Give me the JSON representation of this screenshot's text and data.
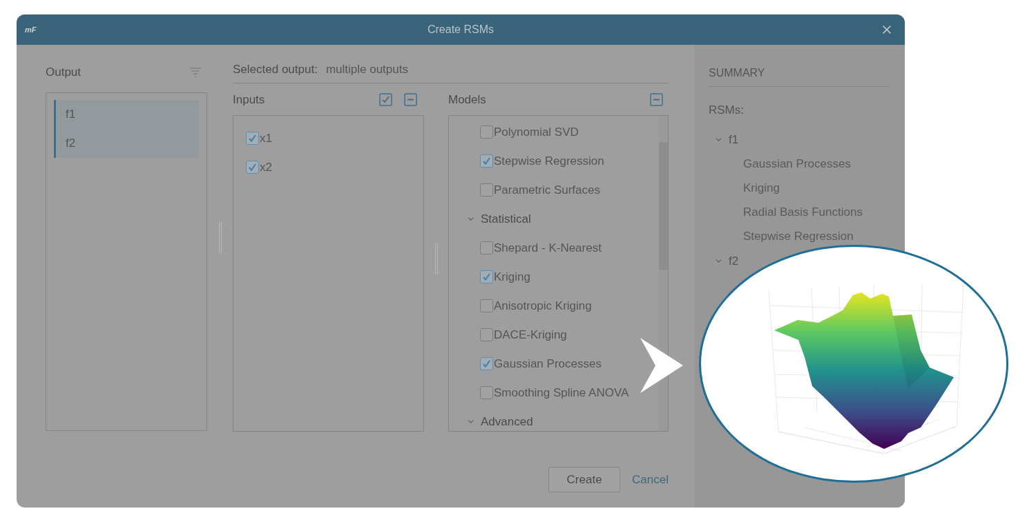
{
  "window": {
    "logo": "mF",
    "title": "Create RSMs"
  },
  "output_panel": {
    "title": "Output",
    "items": [
      {
        "label": "f1",
        "selected": true
      },
      {
        "label": "f2",
        "selected": true
      }
    ]
  },
  "selected_output": {
    "label": "Selected output:",
    "value": "multiple outputs"
  },
  "inputs": {
    "title": "Inputs",
    "items": [
      {
        "label": "x1",
        "checked": true
      },
      {
        "label": "x2",
        "checked": true
      }
    ]
  },
  "models": {
    "title": "Models",
    "items": [
      {
        "kind": "option",
        "label": "Polynomial SVD",
        "checked": false
      },
      {
        "kind": "option",
        "label": "Stepwise Regression",
        "checked": true
      },
      {
        "kind": "option",
        "label": "Parametric Surfaces",
        "checked": false
      },
      {
        "kind": "group",
        "label": "Statistical",
        "expanded": true
      },
      {
        "kind": "option",
        "label": "Shepard - K-Nearest",
        "checked": false
      },
      {
        "kind": "option",
        "label": "Kriging",
        "checked": true
      },
      {
        "kind": "option",
        "label": "Anisotropic Kriging",
        "checked": false
      },
      {
        "kind": "option",
        "label": "DACE-Kriging",
        "checked": false
      },
      {
        "kind": "option",
        "label": "Gaussian Processes",
        "checked": true
      },
      {
        "kind": "option",
        "label": "Smoothing Spline ANOVA",
        "checked": false
      },
      {
        "kind": "group",
        "label": "Advanced",
        "expanded": true
      }
    ]
  },
  "summary": {
    "title": "SUMMARY",
    "subtitle": "RSMs:",
    "outputs": [
      {
        "label": "f1",
        "expanded": true,
        "children": [
          {
            "label": "Gaussian Processes"
          },
          {
            "label": "Kriging"
          },
          {
            "label": "Radial Basis Functions"
          },
          {
            "label": "Stepwise Regression"
          }
        ]
      },
      {
        "label": "f2",
        "expanded": true
      }
    ]
  },
  "buttons": {
    "create": "Create",
    "cancel": "Cancel"
  }
}
